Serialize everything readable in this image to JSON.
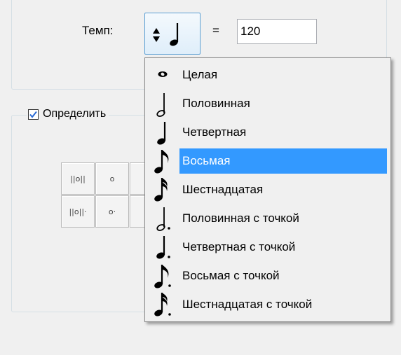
{
  "tempo": {
    "label": "Темп:",
    "equals": "=",
    "bpm_value": "120",
    "selected_note_icon": "quarter-note-icon"
  },
  "detect_group": {
    "label": "Определить",
    "checked": true,
    "buttons": [
      {
        "text": "||o||",
        "icon": "breve-icon"
      },
      {
        "text": "o",
        "icon": "whole-note-icon"
      },
      {
        "text": "||o||·",
        "icon": "dotted-breve-icon"
      },
      {
        "text": "o·",
        "icon": "dotted-whole-note-icon"
      }
    ]
  },
  "dropdown": {
    "selected_index": 3,
    "items": [
      {
        "label": "Целая",
        "icon": "whole-note-icon"
      },
      {
        "label": "Половинная",
        "icon": "half-note-icon"
      },
      {
        "label": "Четвертная",
        "icon": "quarter-note-icon"
      },
      {
        "label": "Восьмая",
        "icon": "eighth-note-icon"
      },
      {
        "label": "Шестнадцатая",
        "icon": "sixteenth-note-icon"
      },
      {
        "label": "Половинная с точкой",
        "icon": "dotted-half-note-icon"
      },
      {
        "label": "Четвертная с точкой",
        "icon": "dotted-quarter-note-icon"
      },
      {
        "label": "Восьмая с точкой",
        "icon": "dotted-eighth-note-icon"
      },
      {
        "label": "Шестнадцатая с точкой",
        "icon": "dotted-sixteenth-note-icon"
      }
    ]
  },
  "colors": {
    "selection": "#3399ff",
    "background": "#f0f0f0"
  }
}
